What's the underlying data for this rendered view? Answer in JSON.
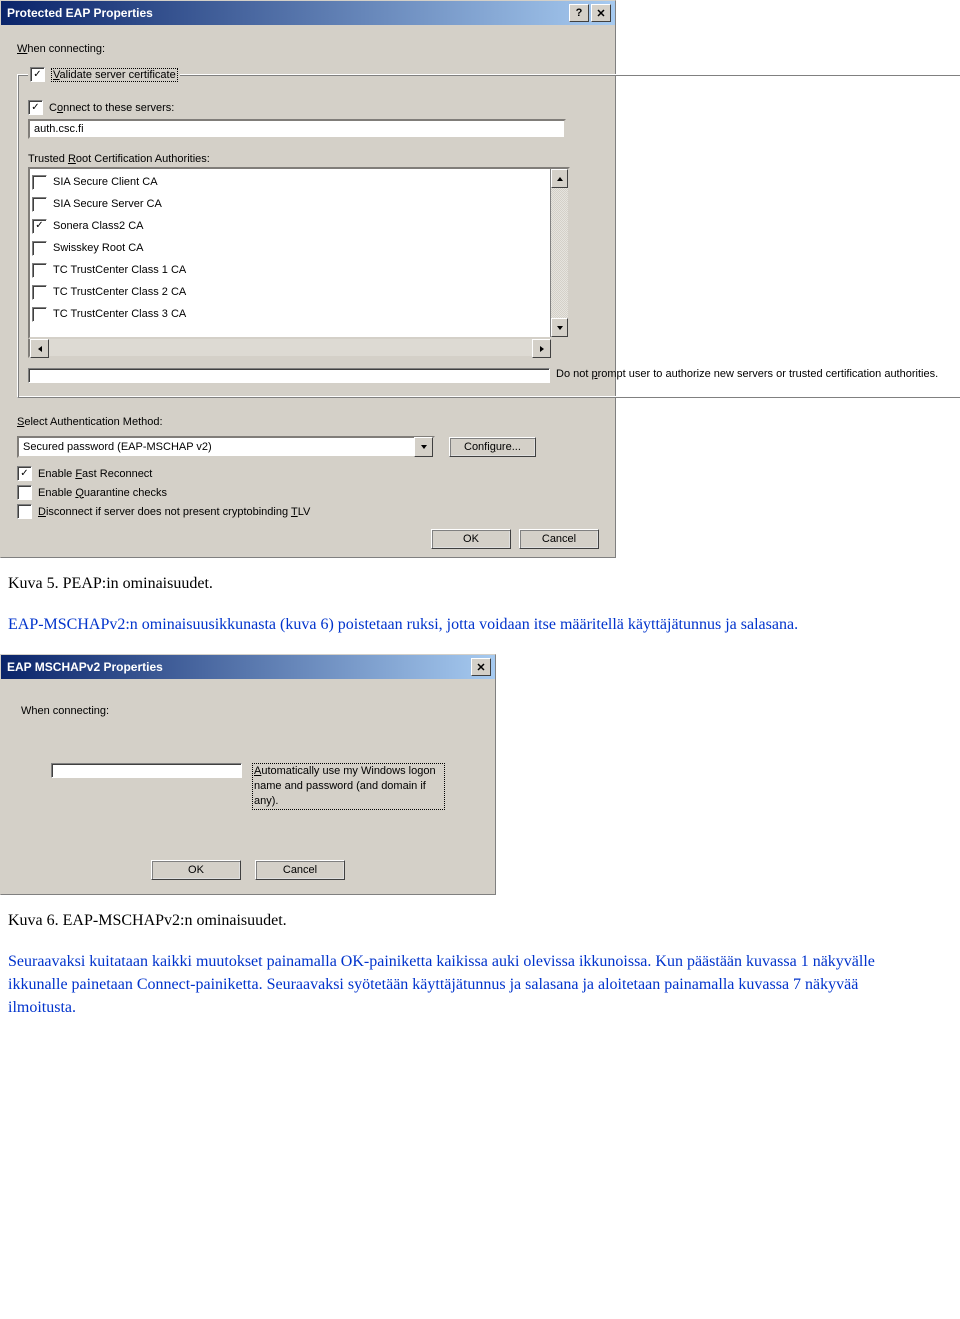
{
  "dialog1": {
    "title": "Protected EAP Properties",
    "help_glyph": "?",
    "close_glyph": "✕",
    "when_connecting": "When connecting:",
    "validate_cert": "Validate server certificate",
    "connect_servers": "Connect to these servers:",
    "server_value": "auth.csc.fi",
    "trca_label": "Trusted Root Certification Authorities:",
    "ca_items": [
      {
        "label": "SIA Secure Client CA",
        "checked": false
      },
      {
        "label": "SIA Secure Server CA",
        "checked": false
      },
      {
        "label": "Sonera Class2 CA",
        "checked": true
      },
      {
        "label": "Swisskey Root CA",
        "checked": false
      },
      {
        "label": "TC TrustCenter Class 1 CA",
        "checked": false
      },
      {
        "label": "TC TrustCenter Class 2 CA",
        "checked": false
      },
      {
        "label": "TC TrustCenter Class 3 CA",
        "checked": false
      }
    ],
    "no_prompt": "Do not prompt user to authorize new servers or trusted certification authorities.",
    "auth_method_label": "Select Authentication Method:",
    "auth_method_value": "Secured password (EAP-MSCHAP v2)",
    "configure": "Configure...",
    "fast_reconnect": "Enable Fast Reconnect",
    "quarantine": "Enable Quarantine checks",
    "cryptobinding": "Disconnect if server does not present cryptobinding TLV",
    "ok": "OK",
    "cancel": "Cancel",
    "check_glyph": "✓"
  },
  "dialog2": {
    "title": "EAP MSCHAPv2 Properties",
    "close_glyph": "✕",
    "when_connecting": "When connecting:",
    "auto_logon": "Automatically use my Windows logon name and password (and domain if any).",
    "ok": "OK",
    "cancel": "Cancel"
  },
  "doc": {
    "caption1": "Kuva 5. PEAP:in ominaisuudet.",
    "para1": "EAP-MSCHAPv2:n ominaisuusikkunasta (kuva 6) poistetaan ruksi, jotta voidaan itse määritellä käyttäjätunnus ja salasana.",
    "caption2": "Kuva 6. EAP-MSCHAPv2:n ominaisuudet.",
    "para2": "Seuraavaksi kuitataan kaikki muutokset painamalla OK-painiketta kaikissa auki olevissa ikkunoissa. Kun päästään kuvassa 1 näkyvälle ikkunalle painetaan Connect-painiketta. Seuraavaksi syötetään käyttäjätunnus ja salasana ja aloitetaan painamalla kuvassa 7 näkyvää ilmoitusta."
  }
}
